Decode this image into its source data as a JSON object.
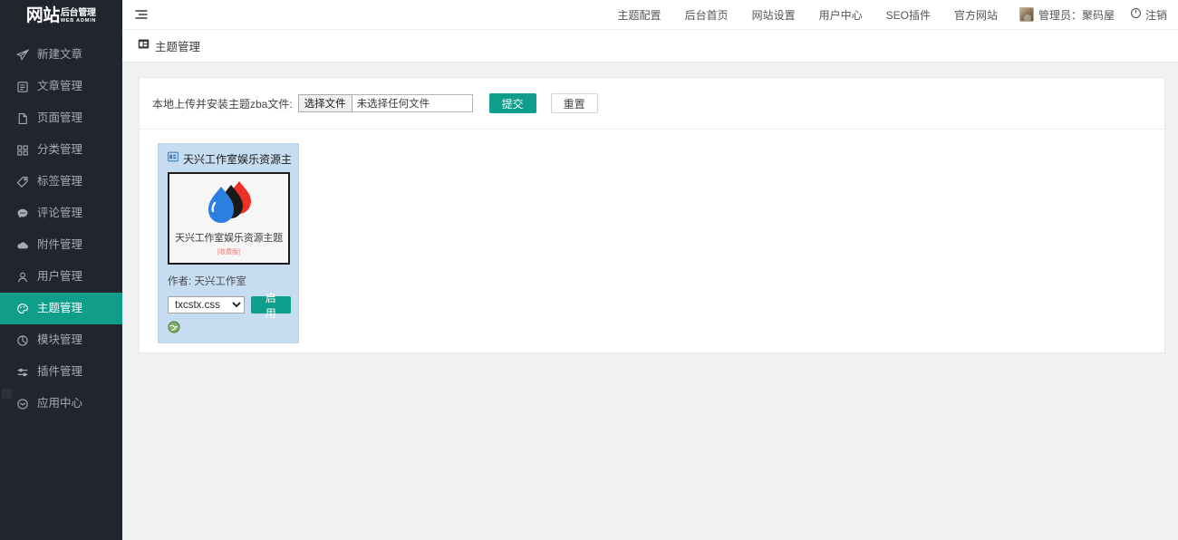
{
  "sidebar": {
    "logo": {
      "main": "网站",
      "sub_top": "后台管理",
      "sub_bottom": "WEB ADMIN"
    },
    "items": [
      {
        "label": "新建文章",
        "icon": "send-icon",
        "active": false
      },
      {
        "label": "文章管理",
        "icon": "document-list-icon",
        "active": false
      },
      {
        "label": "页面管理",
        "icon": "page-icon",
        "active": false
      },
      {
        "label": "分类管理",
        "icon": "category-grid-icon",
        "active": false
      },
      {
        "label": "标签管理",
        "icon": "tag-icon",
        "active": false
      },
      {
        "label": "评论管理",
        "icon": "comment-icon",
        "active": false
      },
      {
        "label": "附件管理",
        "icon": "cloud-icon",
        "active": false
      },
      {
        "label": "用户管理",
        "icon": "user-icon",
        "active": false
      },
      {
        "label": "主题管理",
        "icon": "palette-icon",
        "active": true
      },
      {
        "label": "模块管理",
        "icon": "module-icon",
        "active": false
      },
      {
        "label": "插件管理",
        "icon": "sliders-icon",
        "active": false
      },
      {
        "label": "应用中心",
        "icon": "app-center-icon",
        "active": false
      }
    ]
  },
  "topbar": {
    "hamburger_icon": "hamburger-icon",
    "nav": [
      {
        "label": "主题配置"
      },
      {
        "label": "后台首页"
      },
      {
        "label": "网站设置"
      },
      {
        "label": "用户中心"
      },
      {
        "label": "SEO插件"
      },
      {
        "label": "官方网站"
      }
    ],
    "user": {
      "name": "管理员：聚码屋",
      "avatar_icon": "user-avatar"
    },
    "logout": {
      "label": "注销",
      "icon": "power-icon"
    }
  },
  "breadcrumb": {
    "icon": "theme-icon",
    "title": "主题管理"
  },
  "upload": {
    "label": "本地上传并安装主题zba文件:",
    "file_button": "选择文件",
    "file_placeholder": "未选择任何文件",
    "submit": "提交",
    "reset": "重置"
  },
  "theme": {
    "title": "天兴工作室娱乐资源主题[收费版]",
    "title_icon": "theme-window-icon",
    "preview": {
      "caption": "天兴工作室娱乐资源主题",
      "badge": "[收费版]",
      "logo_icon": "waterdrop-logo",
      "colors": {
        "drop_red": "#ee3124",
        "drop_black": "#1a1a1a",
        "drop_blue": "#2b7fe0"
      }
    },
    "author_label": "作者: 天兴工作室",
    "css_select": {
      "value": "txcstx.css",
      "options": [
        "txcstx.css"
      ]
    },
    "enable_button": "启用",
    "globe_icon": "globe-icon"
  },
  "colors": {
    "accent": "#0f9d8c",
    "sidebar_bg": "#21252d",
    "page_bg": "#f1f1f1",
    "card_bg": "#c6dcf0",
    "badge_red": "#e8766e"
  }
}
